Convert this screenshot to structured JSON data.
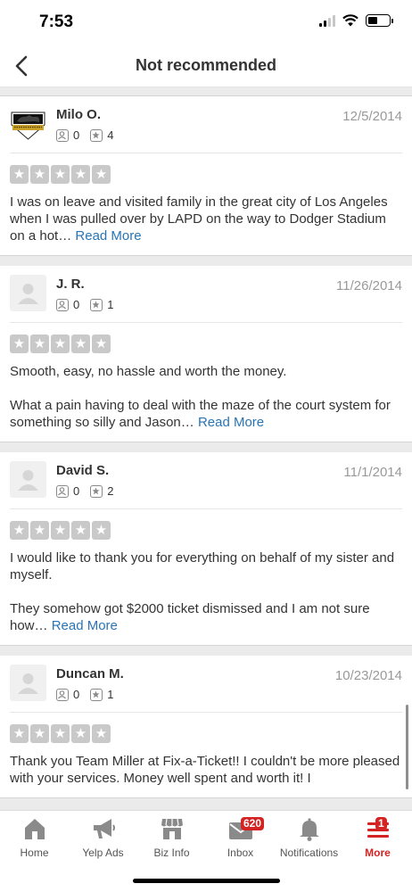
{
  "status": {
    "time": "7:53"
  },
  "nav": {
    "title": "Not recommended"
  },
  "reviews": [
    {
      "user": "Milo O.",
      "date": "12/5/2014",
      "friends": "0",
      "reviews_count": "4",
      "rating": 0,
      "text": "I was on leave and visited family in the great city of Los Angeles when I was pulled over by LAPD on the way to Dodger Stadium on a hot… ",
      "read_more": "Read More",
      "avatar_logo_text": "DIAMOND DOGS"
    },
    {
      "user": "J. R.",
      "date": "11/26/2014",
      "friends": "0",
      "reviews_count": "1",
      "rating": 0,
      "text": "Smooth, easy, no hassle and worth the money.\n\nWhat a pain having to deal with the maze of the court system for something so silly and Jason… ",
      "read_more": "Read More"
    },
    {
      "user": "David S.",
      "date": "11/1/2014",
      "friends": "0",
      "reviews_count": "2",
      "rating": 0,
      "text": "I would like to thank you for everything on behalf of my sister and myself.\n\nThey somehow got $2000 ticket dismissed and I am not sure how… ",
      "read_more": "Read More"
    },
    {
      "user": "Duncan M.",
      "date": "10/23/2014",
      "friends": "0",
      "reviews_count": "1",
      "rating": 0,
      "text": "Thank you Team Miller at Fix-a-Ticket!! I couldn't be more pleased with your services. Money well spent and worth it! I",
      "read_more": ""
    }
  ],
  "tabs": [
    {
      "label": "Home",
      "icon": "home-icon"
    },
    {
      "label": "Yelp Ads",
      "icon": "megaphone-icon"
    },
    {
      "label": "Biz Info",
      "icon": "storefront-icon"
    },
    {
      "label": "Inbox",
      "icon": "mail-icon",
      "badge": "620"
    },
    {
      "label": "Notifications",
      "icon": "bell-icon"
    },
    {
      "label": "More",
      "icon": "menu-icon",
      "badge": "1",
      "active": true
    }
  ],
  "colors": {
    "accent": "#d32323",
    "link": "#2874b5",
    "star_empty": "#c9c9c9"
  }
}
